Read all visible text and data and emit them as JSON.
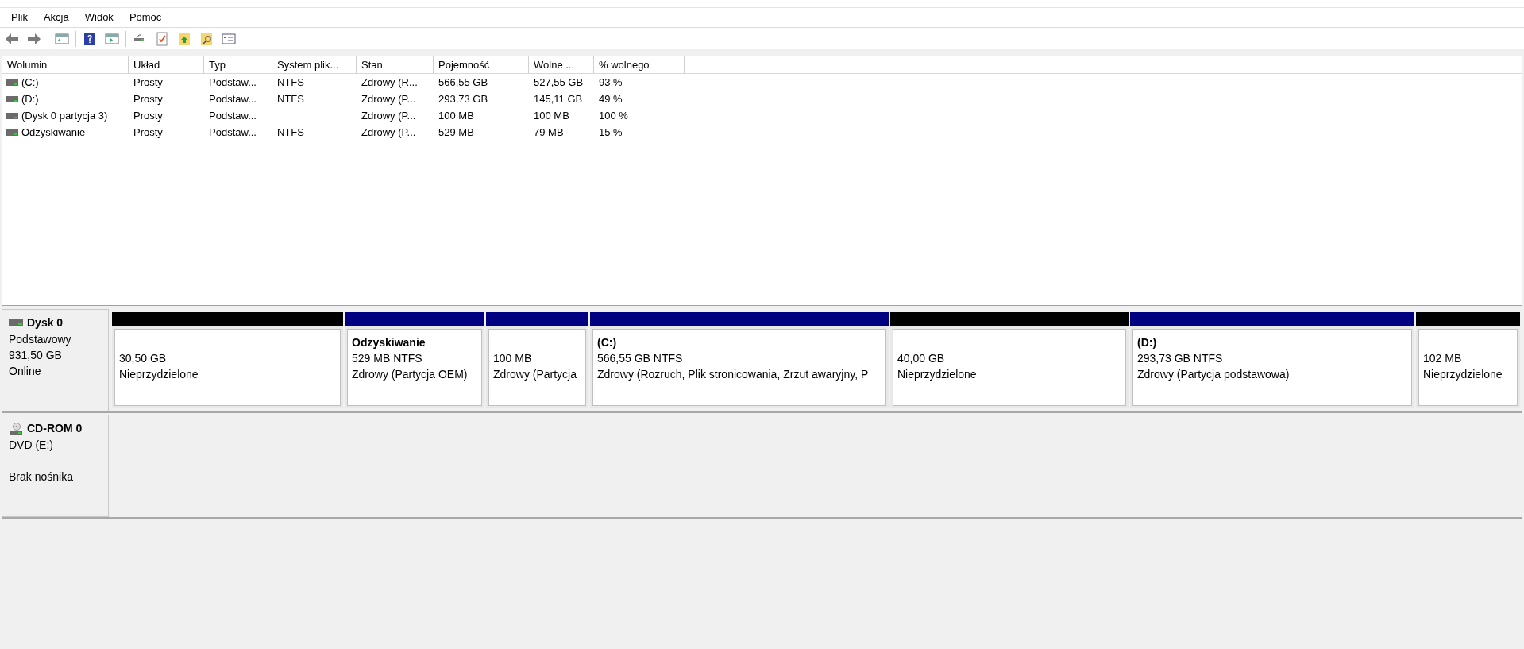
{
  "menu": [
    "Plik",
    "Akcja",
    "Widok",
    "Pomoc"
  ],
  "volumes": {
    "columns": [
      "Wolumin",
      "Układ",
      "Typ",
      "System plik...",
      "Stan",
      "Pojemność",
      "Wolne ...",
      "% wolnego"
    ],
    "rows": [
      [
        "(C:)",
        "Prosty",
        "Podstaw...",
        "NTFS",
        "Zdrowy (R...",
        "566,55 GB",
        "527,55 GB",
        "93 %"
      ],
      [
        "(D:)",
        "Prosty",
        "Podstaw...",
        "NTFS",
        "Zdrowy (P...",
        "293,73 GB",
        "145,11 GB",
        "49 %"
      ],
      [
        "(Dysk 0 partycja 3)",
        "Prosty",
        "Podstaw...",
        "",
        "Zdrowy (P...",
        "100 MB",
        "100 MB",
        "100 %"
      ],
      [
        "Odzyskiwanie",
        "Prosty",
        "Podstaw...",
        "NTFS",
        "Zdrowy (P...",
        "529 MB",
        "79 MB",
        "15 %"
      ]
    ]
  },
  "disks": [
    {
      "kind": "hdd",
      "name": "Dysk 0",
      "lines": [
        "Podstawowy",
        "931,50 GB",
        "Online"
      ],
      "partitions": [
        {
          "kind": "unallocated",
          "size": "30,50 GB",
          "status": "Nieprzydzielone"
        },
        {
          "kind": "primary",
          "name": "Odzyskiwanie",
          "size": "529 MB NTFS",
          "status": "Zdrowy (Partycja OEM)"
        },
        {
          "kind": "primary",
          "size": "100 MB",
          "status": "Zdrowy (Partycja"
        },
        {
          "kind": "primary",
          "name": "(C:)",
          "size": "566,55 GB NTFS",
          "status": "Zdrowy (Rozruch, Plik stronicowania, Zrzut awaryjny, P"
        },
        {
          "kind": "unallocated",
          "size": "40,00 GB",
          "status": "Nieprzydzielone"
        },
        {
          "kind": "primary",
          "name": "(D:)",
          "size": "293,73 GB NTFS",
          "status": "Zdrowy (Partycja podstawowa)"
        },
        {
          "kind": "unallocated",
          "size": "102 MB",
          "status": "Nieprzydzielone"
        }
      ]
    },
    {
      "kind": "cdrom",
      "name": "CD-ROM 0",
      "lines": [
        "DVD (E:)"
      ],
      "status": "Brak nośnika"
    }
  ]
}
